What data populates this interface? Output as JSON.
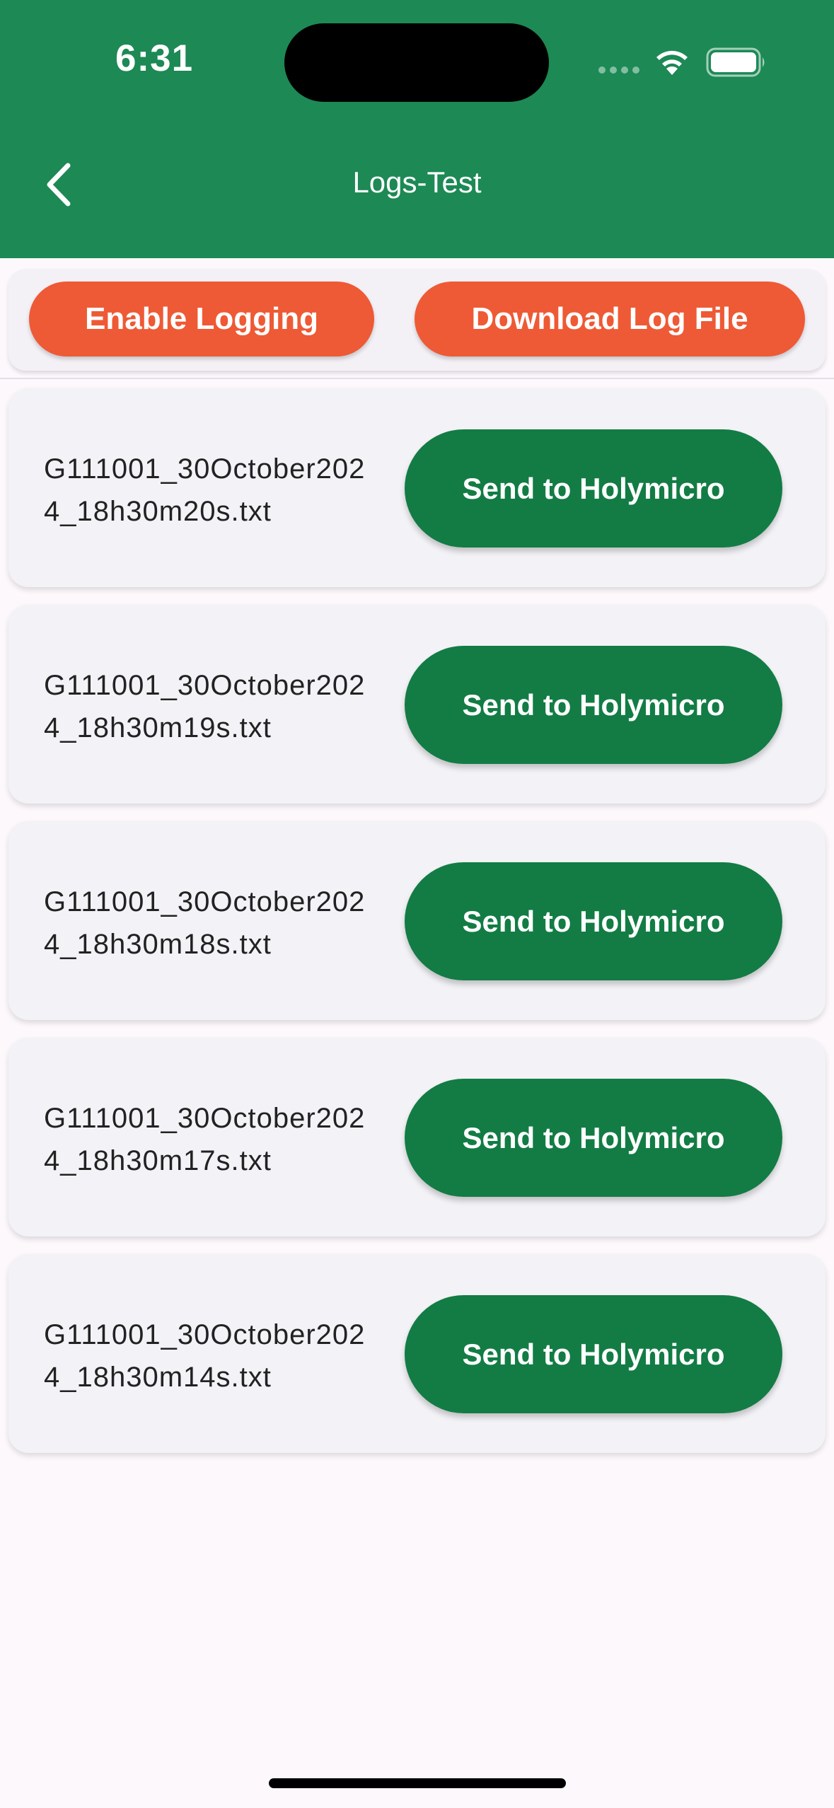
{
  "status_bar": {
    "time": "6:31",
    "signal_icon": "cellular-signal-icon",
    "wifi_icon": "wifi-icon",
    "battery_icon": "battery-icon"
  },
  "header": {
    "title": "Logs-Test",
    "back_icon": "chevron-left-icon",
    "background_color": "#1d8955"
  },
  "actions": {
    "enable_logging_label": "Enable Logging",
    "download_log_label": "Download Log File",
    "accent_color": "#ee5a35"
  },
  "logs": {
    "send_color": "#127c44",
    "items": [
      {
        "filename": "G111001_30October2024_18h30m20s.txt",
        "send_label": "Send to Holymicro"
      },
      {
        "filename": "G111001_30October2024_18h30m19s.txt",
        "send_label": "Send to Holymicro"
      },
      {
        "filename": "G111001_30October2024_18h30m18s.txt",
        "send_label": "Send to Holymicro"
      },
      {
        "filename": "G111001_30October2024_18h30m17s.txt",
        "send_label": "Send to Holymicro"
      },
      {
        "filename": "G111001_30October2024_18h30m14s.txt",
        "send_label": "Send to Holymicro"
      }
    ]
  }
}
